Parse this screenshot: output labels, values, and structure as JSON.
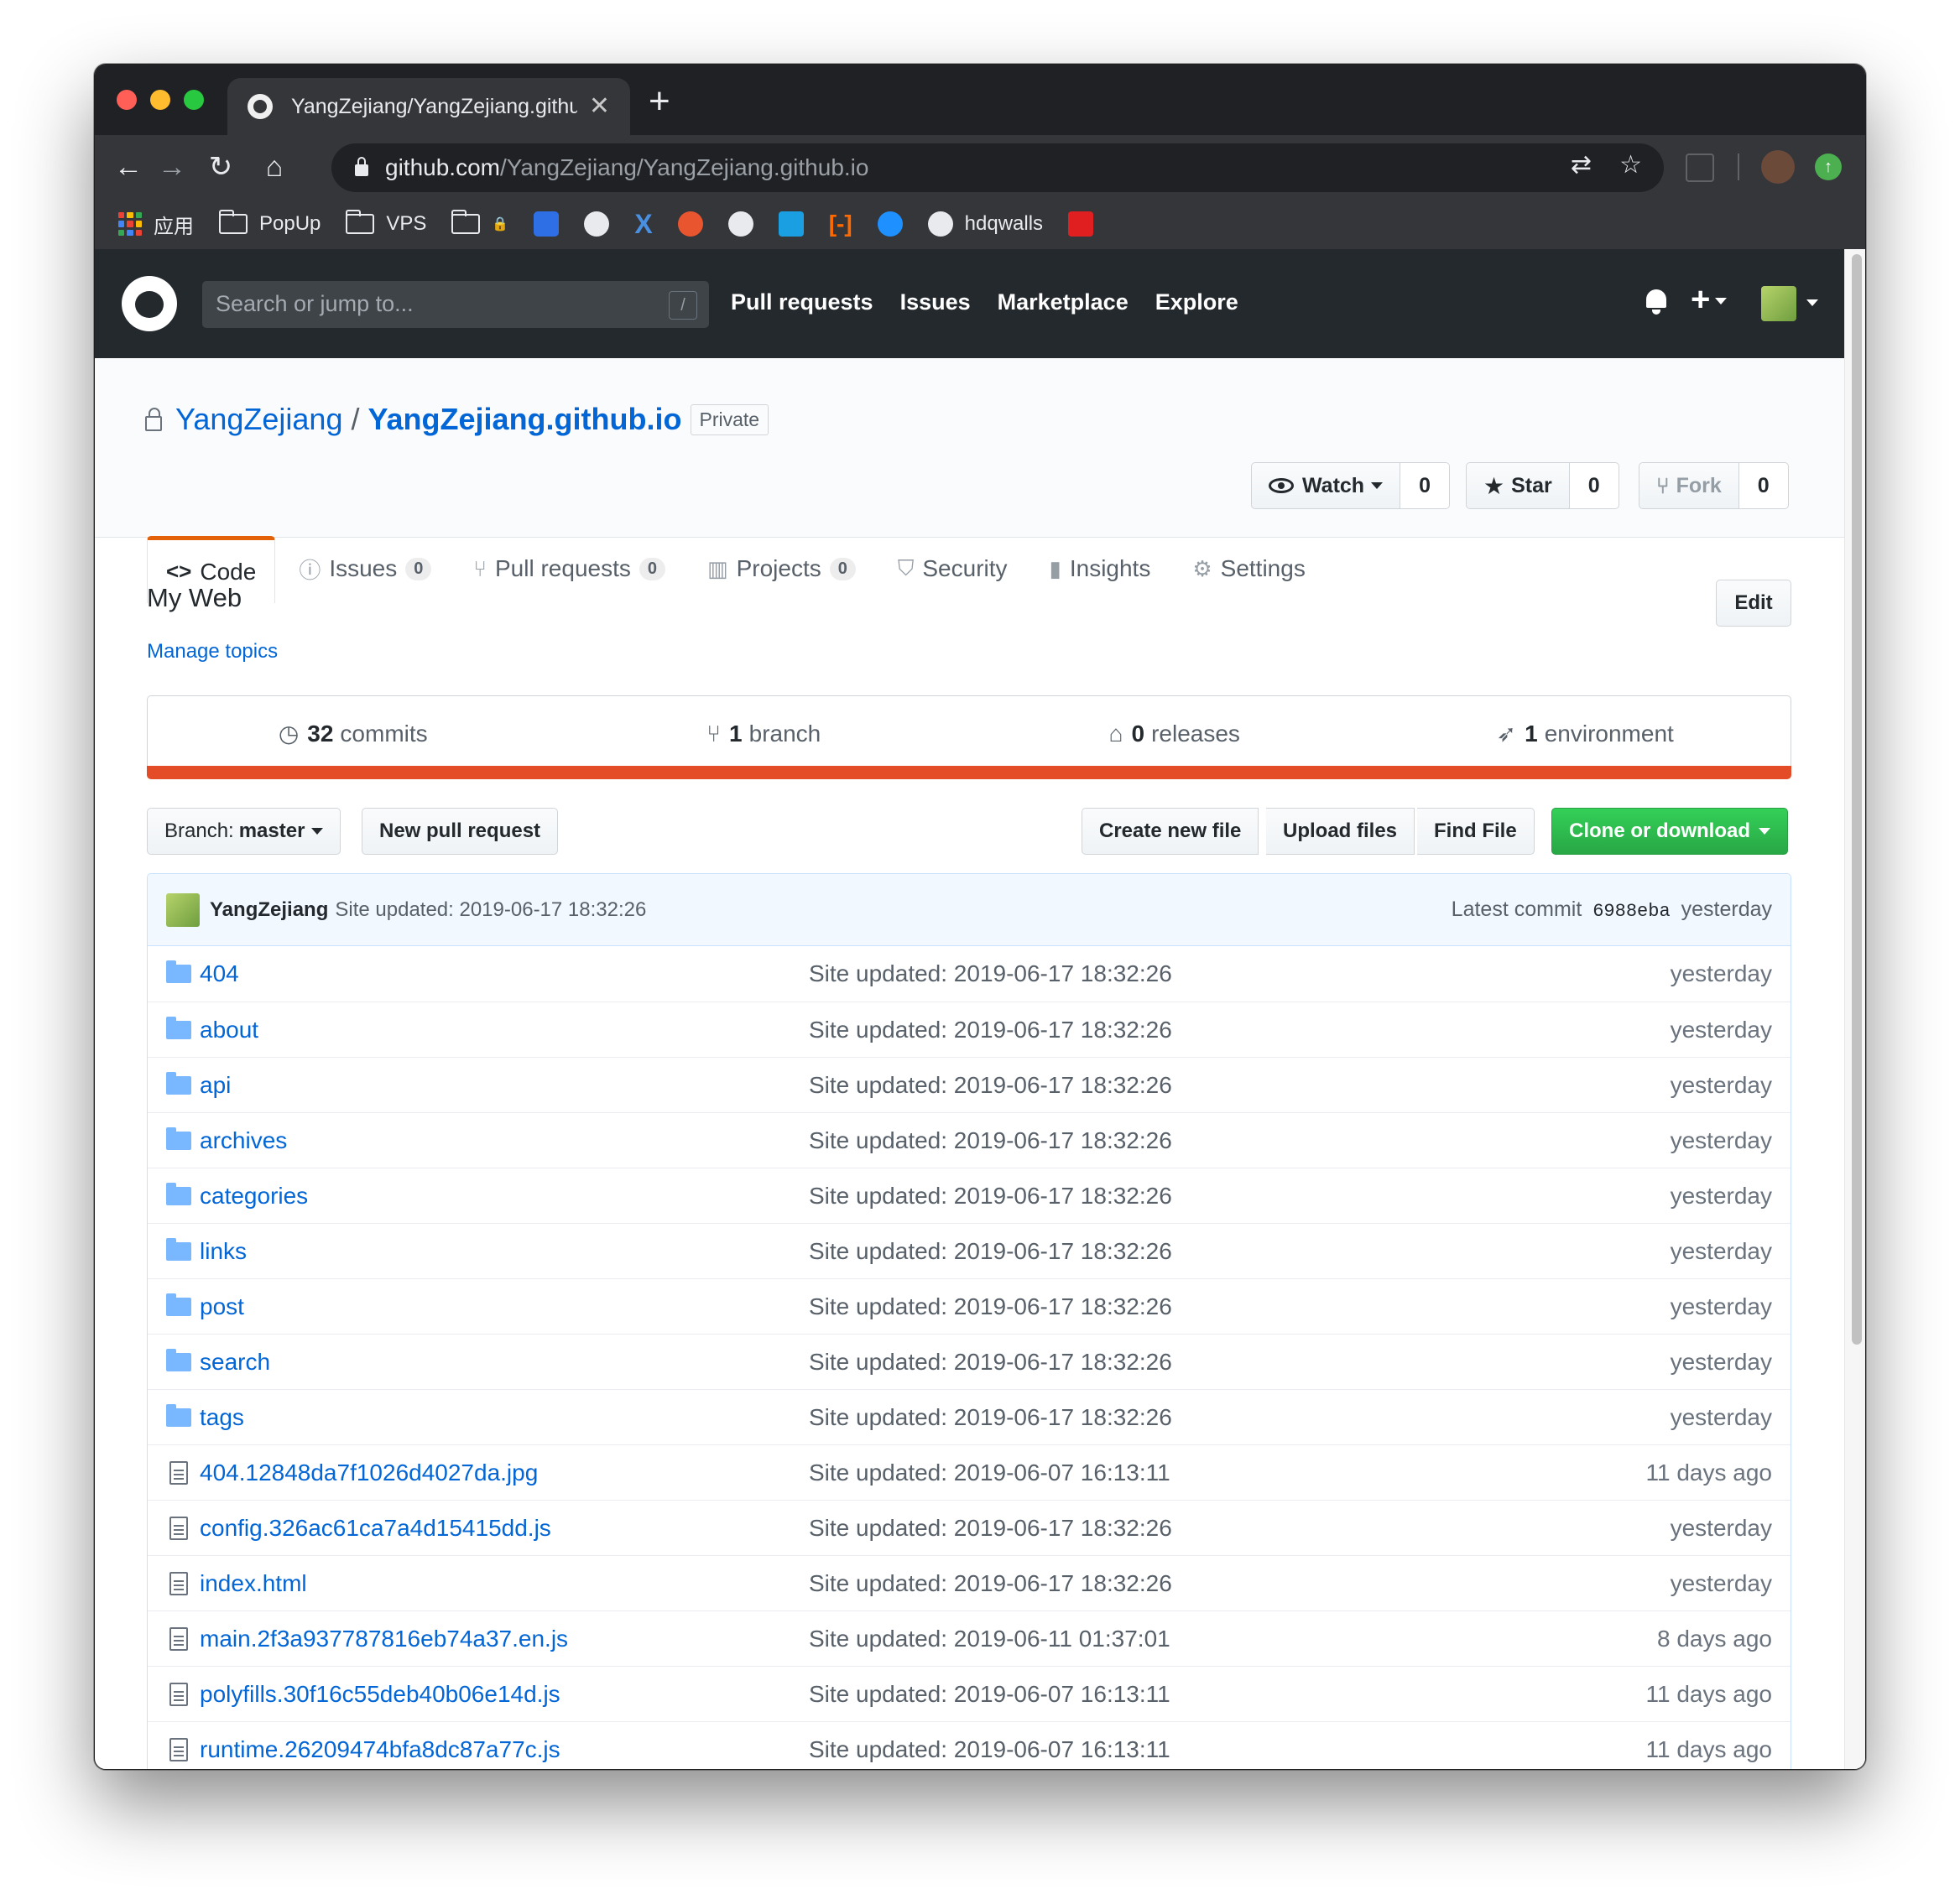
{
  "browser": {
    "tab_title": "YangZejiang/YangZejiang.github.io",
    "url_host": "github.com",
    "url_path": "/YangZejiang/YangZejiang.github.io",
    "bookmarks": [
      {
        "icon": "apps-grid-icon",
        "label": "应用"
      },
      {
        "icon": "folder-icon",
        "label": "PopUp"
      },
      {
        "icon": "folder-icon",
        "label": "VPS"
      },
      {
        "icon": "folder-icon",
        "label": ""
      },
      {
        "icon": "paw-icon",
        "label": ""
      },
      {
        "icon": "github-icon",
        "label": ""
      },
      {
        "icon": "x-icon",
        "label": ""
      },
      {
        "icon": "chat-icon",
        "label": ""
      },
      {
        "icon": "globe-icon",
        "label": ""
      },
      {
        "icon": "alipay-icon",
        "label": ""
      },
      {
        "icon": "bracket-icon",
        "label": ""
      },
      {
        "icon": "bird-icon",
        "label": ""
      },
      {
        "icon": "globe-icon",
        "label": "hdqwalls"
      },
      {
        "icon": "red-badge-icon",
        "label": ""
      }
    ]
  },
  "gh": {
    "search_placeholder": "Search or jump to...",
    "slash_hint": "/",
    "nav": [
      "Pull requests",
      "Issues",
      "Marketplace",
      "Explore"
    ],
    "plus": "+"
  },
  "repo": {
    "owner": "YangZejiang",
    "separator": "/",
    "name": "YangZejiang.github.io",
    "visibility": "Private",
    "watch_label": "Watch",
    "watch_count": "0",
    "star_label": "Star",
    "star_count": "0",
    "fork_label": "Fork",
    "fork_count": "0",
    "tabs": [
      {
        "icon": "<>",
        "label": "Code",
        "count": ""
      },
      {
        "icon": "ⓘ",
        "label": "Issues",
        "count": "0"
      },
      {
        "icon": "⑂",
        "label": "Pull requests",
        "count": "0"
      },
      {
        "icon": "▥",
        "label": "Projects",
        "count": "0"
      },
      {
        "icon": "⛉",
        "label": "Security",
        "count": ""
      },
      {
        "icon": "▮",
        "label": "Insights",
        "count": ""
      },
      {
        "icon": "⚙",
        "label": "Settings",
        "count": ""
      }
    ],
    "description": "My Web",
    "manage_topics": "Manage topics",
    "edit_label": "Edit",
    "summary": {
      "commits_num": "32",
      "commits_label": "commits",
      "branch_num": "1",
      "branch_label": "branch",
      "releases_num": "0",
      "releases_label": "releases",
      "env_num": "1",
      "env_label": "environment"
    },
    "language_color": "#e34c26",
    "branch_prefix": "Branch:",
    "branch_name": "master",
    "new_pr": "New pull request",
    "create_file": "Create new file",
    "upload_files": "Upload files",
    "find_file": "Find File",
    "clone": "Clone or download",
    "latest_commit": {
      "author": "YangZejiang",
      "message": "Site updated: 2019-06-17 18:32:26",
      "prefix": "Latest commit",
      "sha": "6988eba",
      "age": "yesterday"
    },
    "files": [
      {
        "type": "dir",
        "name": "404",
        "message": "Site updated: 2019-06-17 18:32:26",
        "age": "yesterday"
      },
      {
        "type": "dir",
        "name": "about",
        "message": "Site updated: 2019-06-17 18:32:26",
        "age": "yesterday"
      },
      {
        "type": "dir",
        "name": "api",
        "message": "Site updated: 2019-06-17 18:32:26",
        "age": "yesterday"
      },
      {
        "type": "dir",
        "name": "archives",
        "message": "Site updated: 2019-06-17 18:32:26",
        "age": "yesterday"
      },
      {
        "type": "dir",
        "name": "categories",
        "message": "Site updated: 2019-06-17 18:32:26",
        "age": "yesterday"
      },
      {
        "type": "dir",
        "name": "links",
        "message": "Site updated: 2019-06-17 18:32:26",
        "age": "yesterday"
      },
      {
        "type": "dir",
        "name": "post",
        "message": "Site updated: 2019-06-17 18:32:26",
        "age": "yesterday"
      },
      {
        "type": "dir",
        "name": "search",
        "message": "Site updated: 2019-06-17 18:32:26",
        "age": "yesterday"
      },
      {
        "type": "dir",
        "name": "tags",
        "message": "Site updated: 2019-06-17 18:32:26",
        "age": "yesterday"
      },
      {
        "type": "file",
        "name": "404.12848da7f1026d4027da.jpg",
        "message": "Site updated: 2019-06-07 16:13:11",
        "age": "11 days ago"
      },
      {
        "type": "file",
        "name": "config.326ac61ca7a4d15415dd.js",
        "message": "Site updated: 2019-06-17 18:32:26",
        "age": "yesterday"
      },
      {
        "type": "file",
        "name": "index.html",
        "message": "Site updated: 2019-06-17 18:32:26",
        "age": "yesterday"
      },
      {
        "type": "file",
        "name": "main.2f3a937787816eb74a37.en.js",
        "message": "Site updated: 2019-06-11 01:37:01",
        "age": "8 days ago"
      },
      {
        "type": "file",
        "name": "polyfills.30f16c55deb40b06e14d.js",
        "message": "Site updated: 2019-06-07 16:13:11",
        "age": "11 days ago"
      },
      {
        "type": "file",
        "name": "runtime.26209474bfa8dc87a77c.js",
        "message": "Site updated: 2019-06-07 16:13:11",
        "age": "11 days ago"
      }
    ]
  }
}
